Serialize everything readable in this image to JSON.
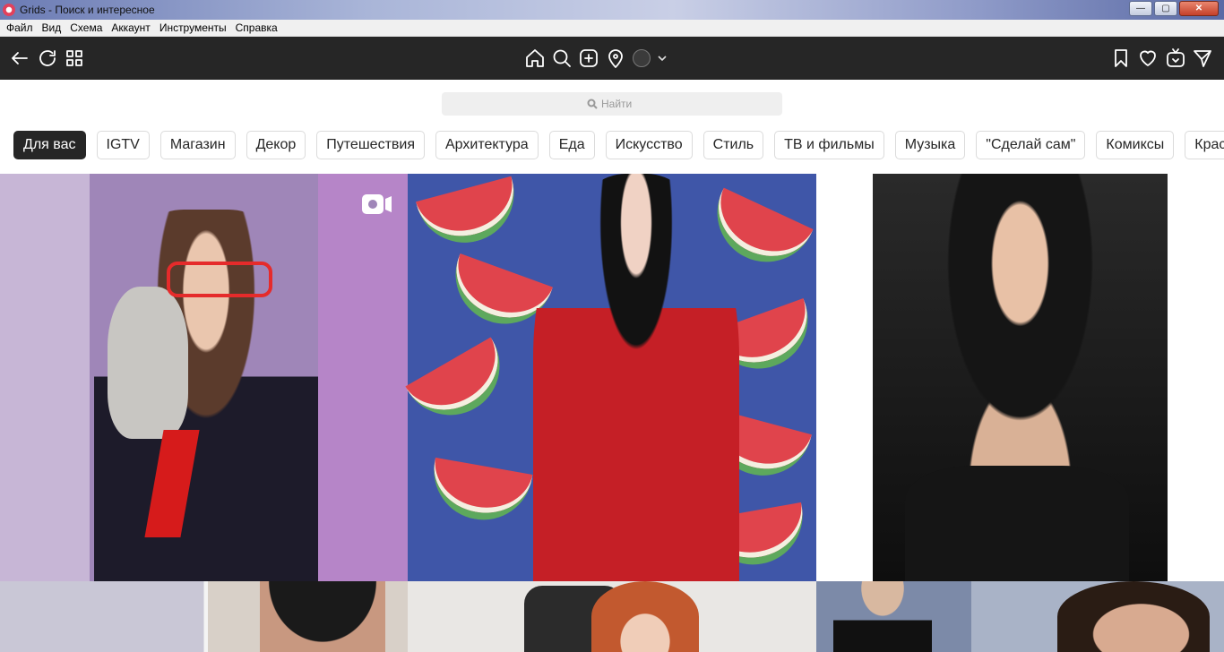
{
  "window": {
    "title": "Grids - Поиск и интересное",
    "controls": {
      "minimize": "—",
      "maximize": "▢",
      "close": "✕"
    }
  },
  "menubar": {
    "items": [
      "Файл",
      "Вид",
      "Схема",
      "Аккаунт",
      "Инструменты",
      "Справка"
    ]
  },
  "toolbar": {
    "left_icons": [
      "back-arrow-icon",
      "refresh-icon",
      "grid-icon"
    ],
    "center_icons": [
      "home-icon",
      "search-icon",
      "add-post-icon",
      "location-icon"
    ],
    "right_icons": [
      "bookmark-icon",
      "heart-icon",
      "igtv-icon",
      "direct-send-icon"
    ]
  },
  "search": {
    "placeholder": "Найти"
  },
  "categories": [
    "Для вас",
    "IGTV",
    "Магазин",
    "Декор",
    "Путешествия",
    "Архитектура",
    "Еда",
    "Искусство",
    "Стиль",
    "ТВ и фильмы",
    "Музыка",
    "\"Сделай сам\"",
    "Комиксы",
    "Красота"
  ],
  "active_category": "Для вас",
  "grid": {
    "tiles": [
      {
        "name": "tile-1",
        "video": true
      },
      {
        "name": "tile-2",
        "video": false
      },
      {
        "name": "tile-3",
        "video": false
      },
      {
        "name": "tile-4",
        "video": false
      },
      {
        "name": "tile-5",
        "video": false
      },
      {
        "name": "tile-6",
        "video": false
      }
    ]
  },
  "colors": {
    "toolbar_bg": "#262626",
    "chip_active_bg": "#262626",
    "chip_border": "#dbdbdb",
    "search_bg": "#efefef"
  }
}
